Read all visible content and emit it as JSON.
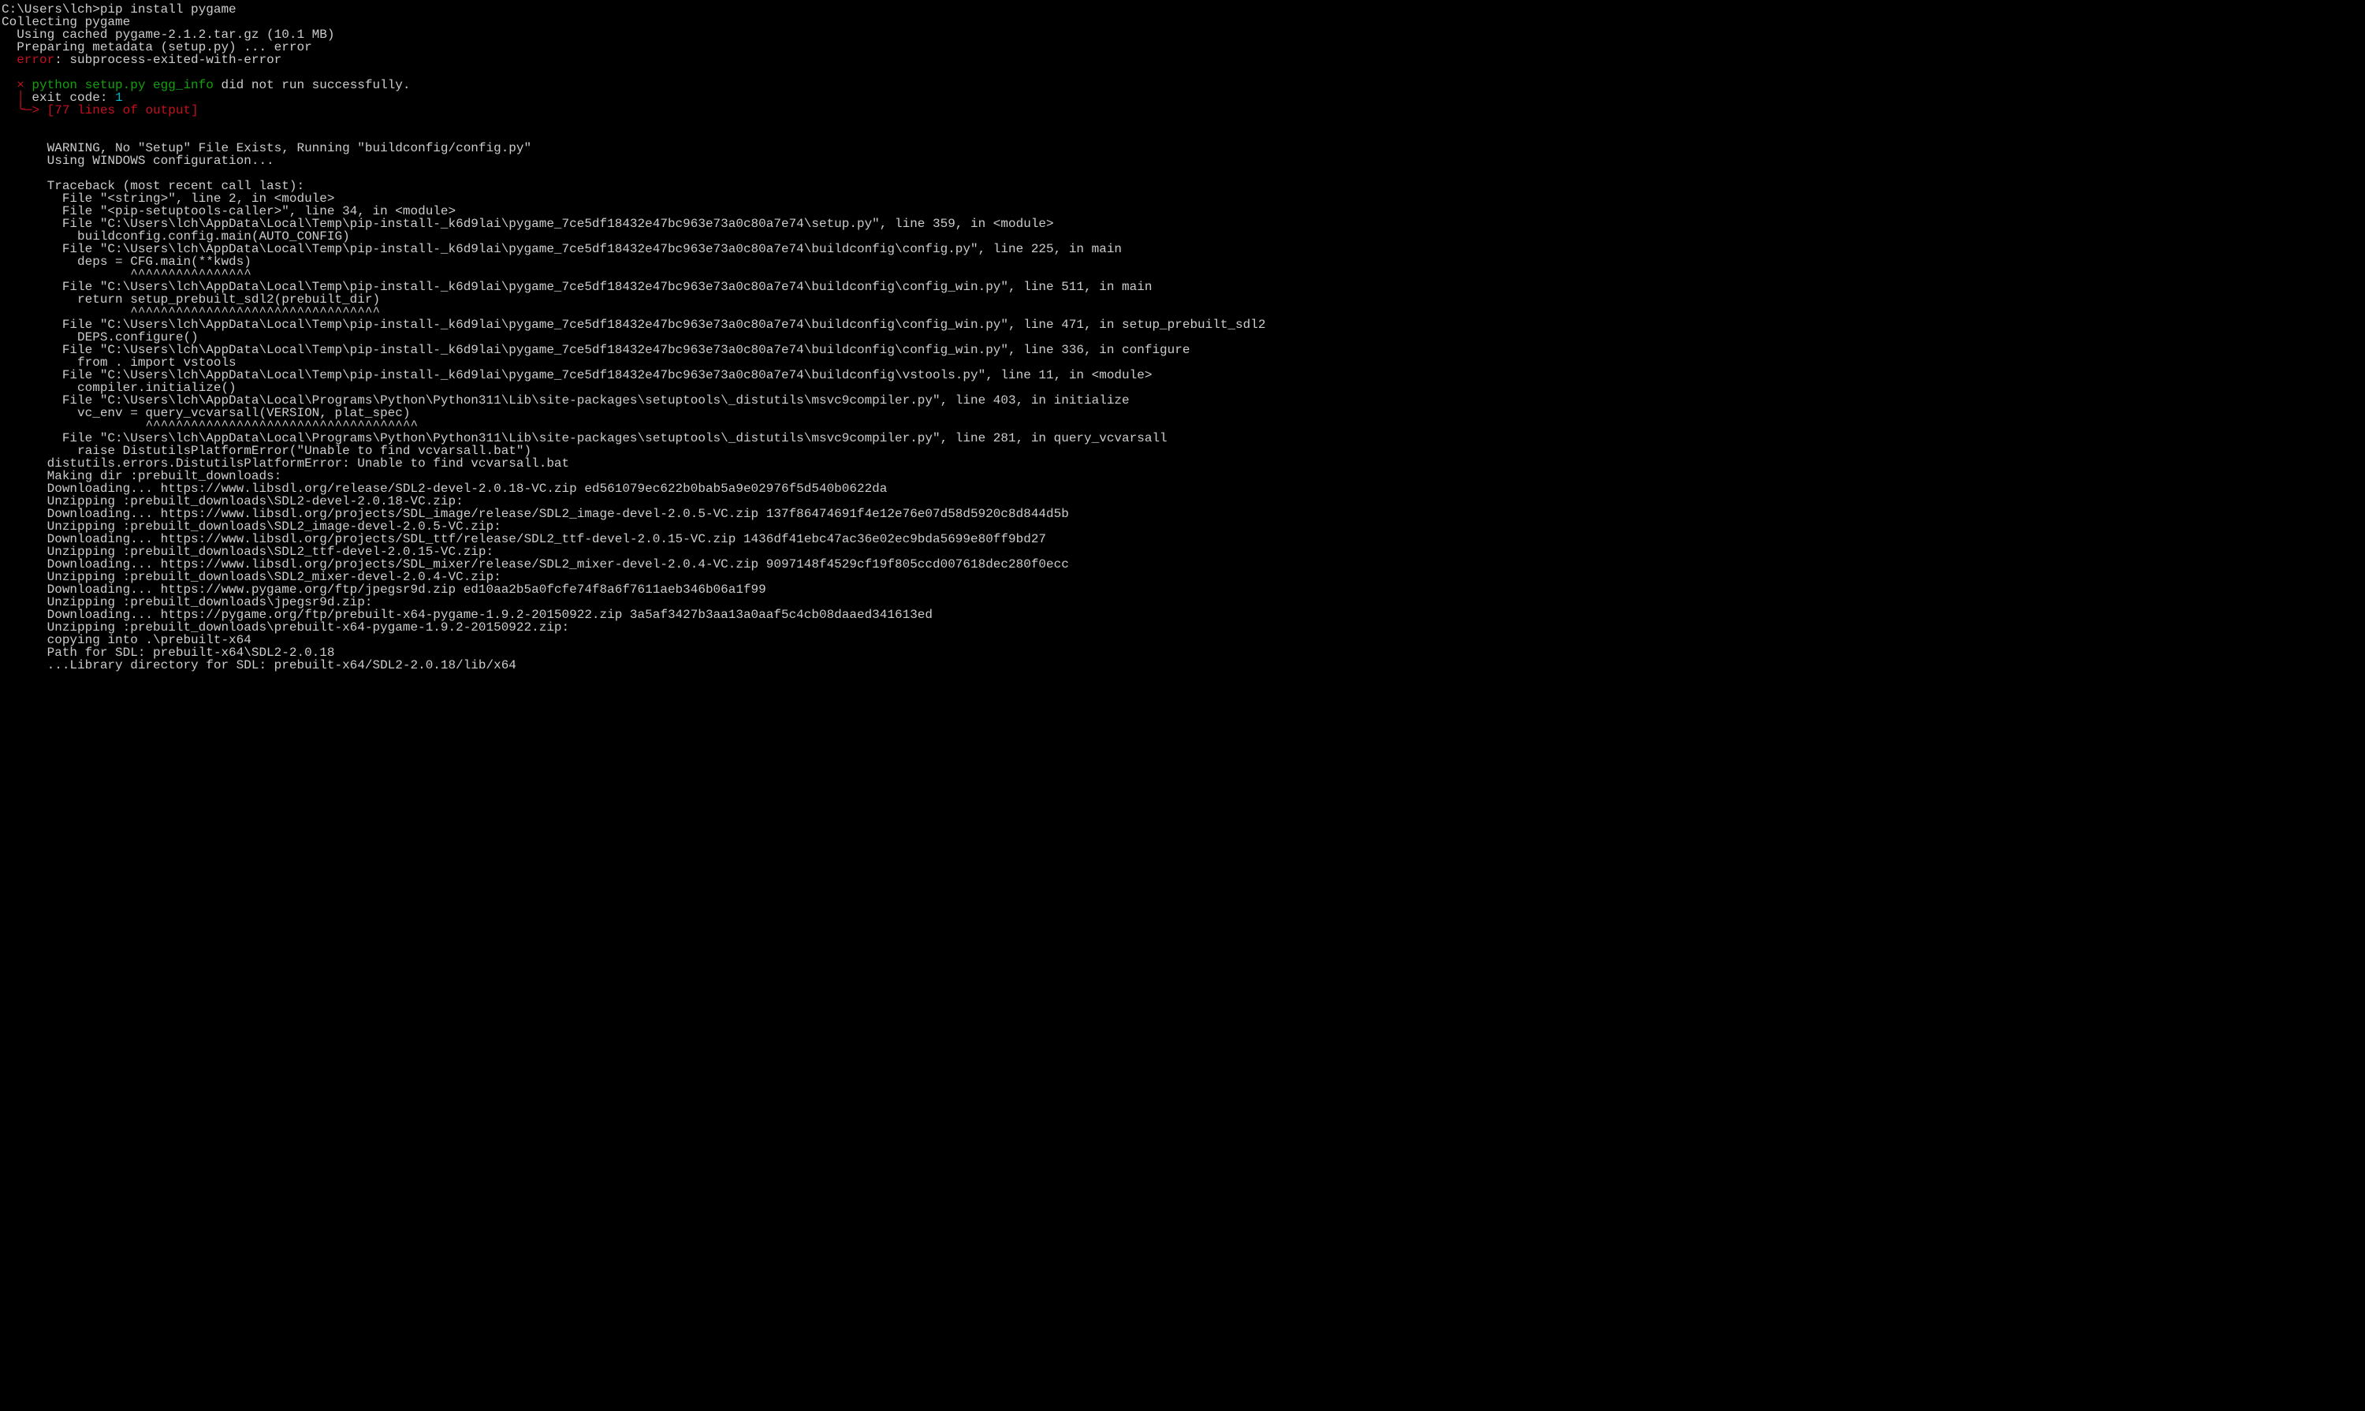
{
  "colors": {
    "background": "#000000",
    "default": "#cccccc",
    "red": "#c50f1f",
    "green": "#13a10e",
    "cyan": "#00b7c3"
  },
  "prompt": {
    "path": "C:\\Users\\lch>",
    "command": "pip install pygame"
  },
  "lines": {
    "collecting": "Collecting pygame",
    "using_cached": "  Using cached pygame-2.1.2.tar.gz (10.1 MB)",
    "preparing": "  Preparing metadata (setup.py) ... error",
    "error_label": "  error",
    "error_rest": ": subprocess-exited-with-error",
    "x_mark": "  ×",
    "egg_info_cmd": " python setup.py egg_info",
    "egg_info_rest": " did not run successfully.",
    "pipe1": "  │",
    "exit_code_label": " exit code: ",
    "exit_code_value": "1",
    "arrow": "  ╰─>",
    "lines_of_output": " [77 lines of output]",
    "blank": "",
    "blank2": "",
    "warning": "      WARNING, No \"Setup\" File Exists, Running \"buildconfig/config.py\"",
    "using_windows": "      Using WINDOWS configuration...",
    "blank3": "",
    "traceback": "      Traceback (most recent call last):",
    "f1": "        File \"<string>\", line 2, in <module>",
    "f2": "        File \"<pip-setuptools-caller>\", line 34, in <module>",
    "f3": "        File \"C:\\Users\\lch\\AppData\\Local\\Temp\\pip-install-_k6d9lai\\pygame_7ce5df18432e47bc963e73a0c80a7e74\\setup.py\", line 359, in <module>",
    "f3b": "          buildconfig.config.main(AUTO_CONFIG)",
    "f4": "        File \"C:\\Users\\lch\\AppData\\Local\\Temp\\pip-install-_k6d9lai\\pygame_7ce5df18432e47bc963e73a0c80a7e74\\buildconfig\\config.py\", line 225, in main",
    "f4b": "          deps = CFG.main(**kwds)",
    "f4c": "                 ^^^^^^^^^^^^^^^^",
    "f5": "        File \"C:\\Users\\lch\\AppData\\Local\\Temp\\pip-install-_k6d9lai\\pygame_7ce5df18432e47bc963e73a0c80a7e74\\buildconfig\\config_win.py\", line 511, in main",
    "f5b": "          return setup_prebuilt_sdl2(prebuilt_dir)",
    "f5c": "                 ^^^^^^^^^^^^^^^^^^^^^^^^^^^^^^^^^",
    "f6": "        File \"C:\\Users\\lch\\AppData\\Local\\Temp\\pip-install-_k6d9lai\\pygame_7ce5df18432e47bc963e73a0c80a7e74\\buildconfig\\config_win.py\", line 471, in setup_prebuilt_sdl2",
    "f6b": "          DEPS.configure()",
    "f7": "        File \"C:\\Users\\lch\\AppData\\Local\\Temp\\pip-install-_k6d9lai\\pygame_7ce5df18432e47bc963e73a0c80a7e74\\buildconfig\\config_win.py\", line 336, in configure",
    "f7b": "          from . import vstools",
    "f8": "        File \"C:\\Users\\lch\\AppData\\Local\\Temp\\pip-install-_k6d9lai\\pygame_7ce5df18432e47bc963e73a0c80a7e74\\buildconfig\\vstools.py\", line 11, in <module>",
    "f8b": "          compiler.initialize()",
    "f9": "        File \"C:\\Users\\lch\\AppData\\Local\\Programs\\Python\\Python311\\Lib\\site-packages\\setuptools\\_distutils\\msvc9compiler.py\", line 403, in initialize",
    "f9b": "          vc_env = query_vcvarsall(VERSION, plat_spec)",
    "f9c": "                   ^^^^^^^^^^^^^^^^^^^^^^^^^^^^^^^^^^^^",
    "f10": "        File \"C:\\Users\\lch\\AppData\\Local\\Programs\\Python\\Python311\\Lib\\site-packages\\setuptools\\_distutils\\msvc9compiler.py\", line 281, in query_vcvarsall",
    "f10b": "          raise DistutilsPlatformError(\"Unable to find vcvarsall.bat\")",
    "distutils_err": "      distutils.errors.DistutilsPlatformError: Unable to find vcvarsall.bat",
    "making_dir": "      Making dir :prebuilt_downloads:",
    "dl1": "      Downloading... https://www.libsdl.org/release/SDL2-devel-2.0.18-VC.zip ed561079ec622b0bab5a9e02976f5d540b0622da",
    "uz1": "      Unzipping :prebuilt_downloads\\SDL2-devel-2.0.18-VC.zip:",
    "dl2": "      Downloading... https://www.libsdl.org/projects/SDL_image/release/SDL2_image-devel-2.0.5-VC.zip 137f86474691f4e12e76e07d58d5920c8d844d5b",
    "uz2": "      Unzipping :prebuilt_downloads\\SDL2_image-devel-2.0.5-VC.zip:",
    "dl3": "      Downloading... https://www.libsdl.org/projects/SDL_ttf/release/SDL2_ttf-devel-2.0.15-VC.zip 1436df41ebc47ac36e02ec9bda5699e80ff9bd27",
    "uz3": "      Unzipping :prebuilt_downloads\\SDL2_ttf-devel-2.0.15-VC.zip:",
    "dl4": "      Downloading... https://www.libsdl.org/projects/SDL_mixer/release/SDL2_mixer-devel-2.0.4-VC.zip 9097148f4529cf19f805ccd007618dec280f0ecc",
    "uz4": "      Unzipping :prebuilt_downloads\\SDL2_mixer-devel-2.0.4-VC.zip:",
    "dl5": "      Downloading... https://www.pygame.org/ftp/jpegsr9d.zip ed10aa2b5a0fcfe74f8a6f7611aeb346b06a1f99",
    "uz5": "      Unzipping :prebuilt_downloads\\jpegsr9d.zip:",
    "dl6": "      Downloading... https://pygame.org/ftp/prebuilt-x64-pygame-1.9.2-20150922.zip 3a5af3427b3aa13a0aaf5c4cb08daaed341613ed",
    "uz6": "      Unzipping :prebuilt_downloads\\prebuilt-x64-pygame-1.9.2-20150922.zip:",
    "copying": "      copying into .\\prebuilt-x64",
    "path_sdl": "      Path for SDL: prebuilt-x64\\SDL2-2.0.18",
    "lib_dir": "      ...Library directory for SDL: prebuilt-x64/SDL2-2.0.18/lib/x64"
  }
}
